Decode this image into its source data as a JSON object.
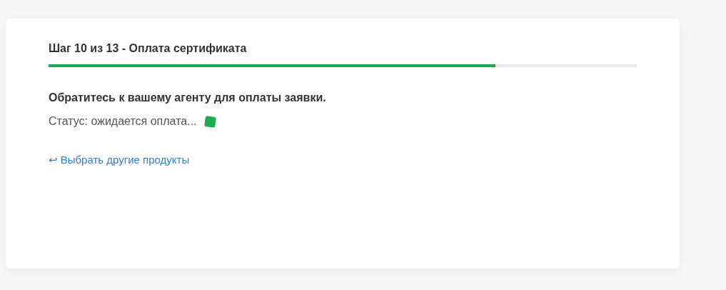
{
  "step": {
    "title": "Шаг 10 из 13 - Оплата сертификата",
    "level": 0.76
  },
  "message": "Обратитесь к вашему агенту для оплаты заявки.",
  "status": {
    "text": "Статус: ожидается оплата...",
    "color": "#1aae4e"
  },
  "link": {
    "arrow": "↩",
    "label": "Выбрать другие продукты"
  }
}
